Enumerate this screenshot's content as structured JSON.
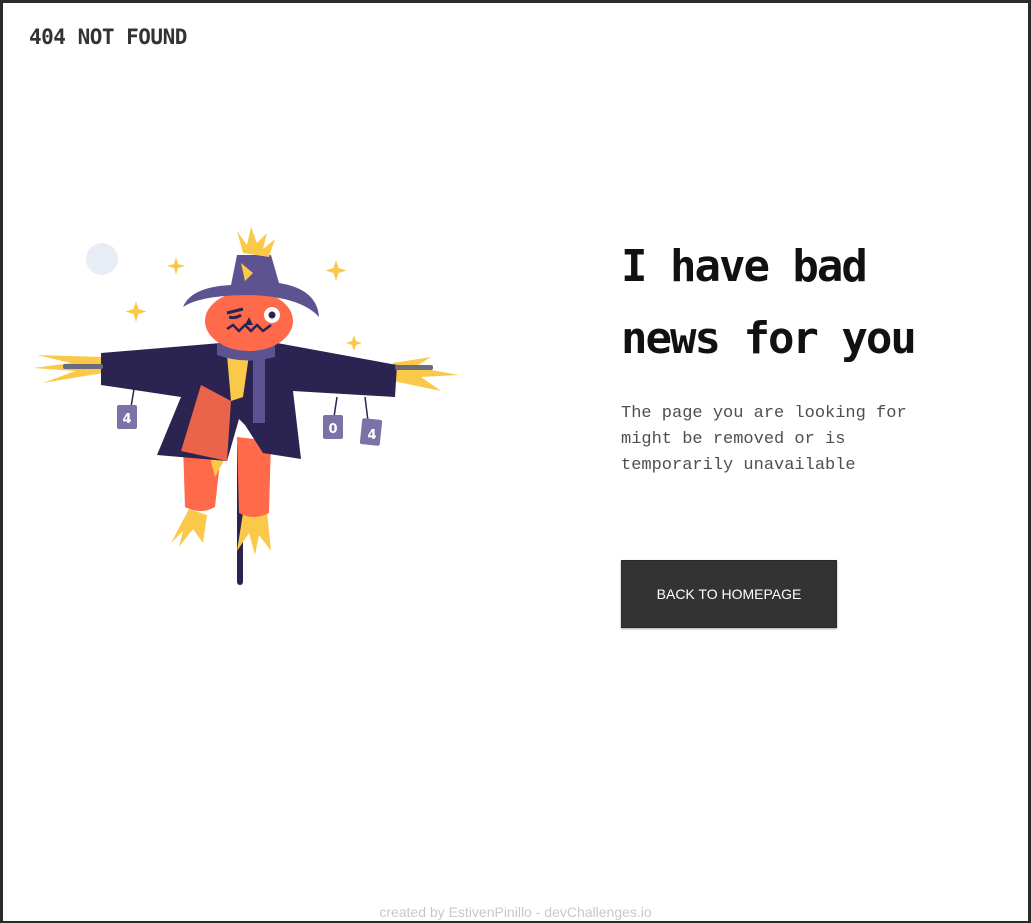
{
  "header": {
    "brand": "404 NOT FOUND"
  },
  "illustration": {
    "can_digits": [
      "4",
      "0",
      "4"
    ],
    "icon": "scarecrow-illustration"
  },
  "main": {
    "headline_line1": "I have bad",
    "headline_line2": "news for you",
    "message": "The page you are looking for might be removed or is temporarily unavailable",
    "button_label": "BACK TO HOMEPAGE"
  },
  "footer": {
    "credit": "created by EstivenPinillo - devChallenges.io"
  },
  "colors": {
    "button_bg": "#333333",
    "coat": "#2b2350",
    "hat": "#5e5391",
    "face": "#ff6a4a",
    "straw": "#fbc94a"
  }
}
